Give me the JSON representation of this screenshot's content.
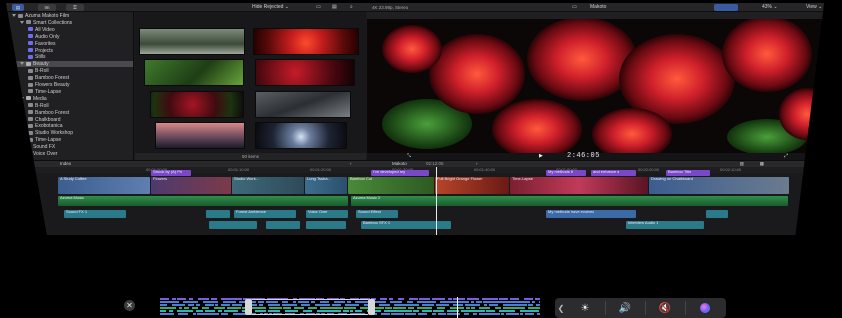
{
  "toolbar": {
    "import_label": "Im",
    "hide_rejected": "Hide Rejected",
    "hide_rejected_chevron": "⌄",
    "format": "4K 23.98p, Stereo",
    "project_name": "Makoto",
    "zoom": "43%",
    "zoom_chevron": "⌄",
    "view_label": "View",
    "view_chevron": "⌄"
  },
  "library": {
    "items": [
      {
        "label": "Azuma Makoto Film",
        "icon": "library-icon",
        "indent": 0,
        "tri": true
      },
      {
        "label": "Smart Collections",
        "icon": "folder-icon",
        "indent": 1,
        "tri": true
      },
      {
        "label": "All Video",
        "icon": "smart-collection-icon",
        "indent": 2
      },
      {
        "label": "Audio Only",
        "icon": "smart-collection-icon",
        "indent": 2
      },
      {
        "label": "Favorites",
        "icon": "smart-collection-icon",
        "indent": 2
      },
      {
        "label": "Projects",
        "icon": "smart-collection-icon",
        "indent": 2
      },
      {
        "label": "Stills",
        "icon": "smart-collection-icon",
        "indent": 2
      },
      {
        "label": "Beauty",
        "icon": "event-icon",
        "indent": 1,
        "tri": true,
        "selected": true
      },
      {
        "label": "B-Roll",
        "icon": "keyword-icon",
        "indent": 2
      },
      {
        "label": "Bamboo Forest",
        "icon": "keyword-icon",
        "indent": 2
      },
      {
        "label": "Flowers Beauty",
        "icon": "keyword-icon",
        "indent": 2
      },
      {
        "label": "Time-Lapse",
        "icon": "keyword-icon",
        "indent": 2
      },
      {
        "label": "Media",
        "icon": "event-icon",
        "indent": 1,
        "tri": true
      },
      {
        "label": "B-Roll",
        "icon": "keyword-icon",
        "indent": 2
      },
      {
        "label": "Bamboo Forest",
        "icon": "keyword-icon",
        "indent": 2
      },
      {
        "label": "Chalkboard",
        "icon": "keyword-icon",
        "indent": 2
      },
      {
        "label": "Exobotanica",
        "icon": "keyword-icon",
        "indent": 2
      },
      {
        "label": "Studio Workshop",
        "icon": "keyword-icon",
        "indent": 2
      },
      {
        "label": "Time-Lapse",
        "icon": "keyword-icon",
        "indent": 2
      },
      {
        "label": "Sound FX",
        "icon": "event-icon",
        "indent": 1,
        "tri": true
      },
      {
        "label": "Voice Over",
        "icon": "event-icon",
        "indent": 1,
        "tri": true
      }
    ]
  },
  "browser": {
    "footer": "50 items"
  },
  "viewer": {
    "timecode": "2:46:05"
  },
  "timeline_bar": {
    "index_label": "Index",
    "project_name": "Makoto",
    "duration": "02:12:05"
  },
  "ruler": {
    "ticks": [
      "00:01:00:00",
      "00:01:10:00",
      "00:01:20:00",
      "00:01:30:00",
      "00:01:40:00",
      "00:01:50:00",
      "00:02:00:00",
      "00:02:10:00"
    ]
  },
  "timeline": {
    "title_clips": [
      "Struck by (A) Pri",
      "I've developed my",
      "My methods fi",
      "and enhance a",
      "Bamboo Title"
    ],
    "video_clips": [
      "A Study Coffee",
      "Flowers",
      "Studio Work...",
      "Lung Tsuba...",
      "Bamboo Cut",
      "Full Bright Orange Flower",
      "Time-Lapse",
      "Drawing on Chalkboard"
    ],
    "music_label": "Azuma Music",
    "music_label_2": "Azuma Music 2",
    "audio_clips": [
      "Sound FX 1",
      "Forest Ambience",
      "Voice Over",
      "Sound Effect",
      "My methods have evolved",
      "Interview Audio 1"
    ],
    "fx_label": "Bamboo SFX 1"
  },
  "touchbar": {
    "esc_label": "✕",
    "brightness": "☀",
    "volume": "🔊",
    "mute": "🔇",
    "collapse": "❮"
  },
  "colors": {
    "accent": "#6f6ff0",
    "video_clip": "#3b5d8f",
    "audio_clip": "#2f8b6a",
    "title_clip": "#7a47c8",
    "music": "#2b7e45"
  }
}
